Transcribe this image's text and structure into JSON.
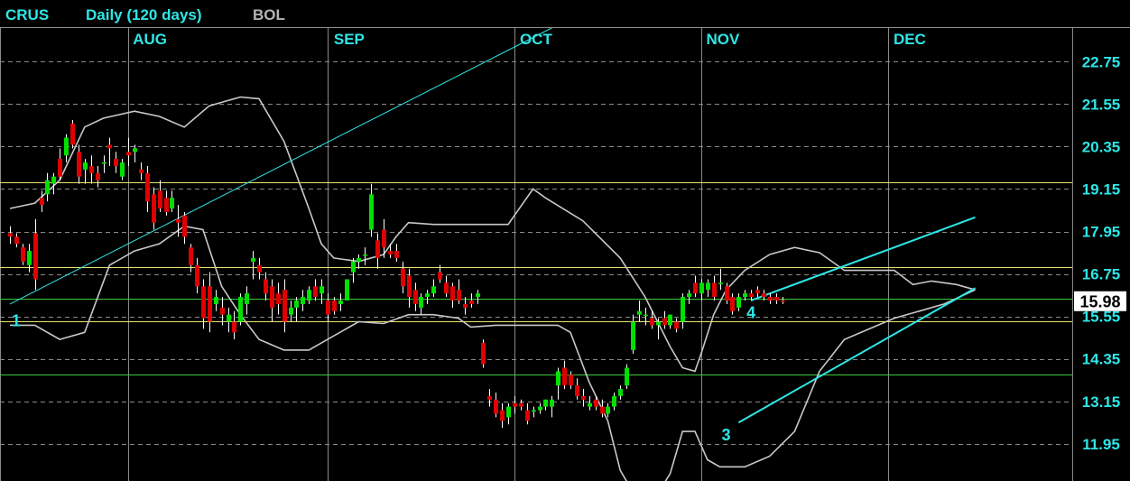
{
  "header": {
    "symbol": "CRUS",
    "period": "Daily (120 days)",
    "indicator": "BOL"
  },
  "colors": {
    "background": "#000000",
    "grid": "#8a8a8a",
    "axis_text": "#2ee6e6",
    "symbol_text": "#2ee6e6",
    "indicator_text": "#b4b4b4",
    "up_candle": "#00e000",
    "down_candle": "#e00000",
    "bollinger": "#c8c8c8",
    "trendline": "#2ee6e6",
    "h_line_yellow": "#e6e66e",
    "h_line_green": "#3cc83c",
    "last_price_bg": "#ffffff"
  },
  "chart_data": {
    "type": "candlestick",
    "y_ticks": [
      "22.75",
      "21.55",
      "20.35",
      "19.15",
      "17.95",
      "16.75",
      "15.55",
      "14.35",
      "13.15",
      "11.95"
    ],
    "ylim": [
      10.9,
      23.7
    ],
    "month_labels": [
      {
        "label": "AUG",
        "bar": 19
      },
      {
        "label": "SEP",
        "bar": 51
      },
      {
        "label": "OCT",
        "bar": 81
      },
      {
        "label": "NOV",
        "bar": 111
      },
      {
        "label": "DEC",
        "bar": 141
      }
    ],
    "last_price": "15.98",
    "last_price_value": 15.98,
    "candles": [
      [
        17.9,
        18.1,
        17.6,
        17.8
      ],
      [
        17.8,
        17.9,
        17.5,
        17.6
      ],
      [
        17.5,
        17.6,
        17.0,
        17.1
      ],
      [
        17.0,
        17.6,
        16.8,
        17.4
      ],
      [
        17.9,
        18.3,
        16.3,
        16.6
      ],
      [
        18.9,
        19.1,
        18.5,
        18.7
      ],
      [
        19.0,
        19.6,
        18.8,
        19.4
      ],
      [
        19.3,
        19.6,
        19.0,
        19.5
      ],
      [
        20.0,
        20.3,
        19.4,
        19.5
      ],
      [
        20.1,
        20.7,
        19.9,
        20.6
      ],
      [
        21.0,
        21.1,
        20.3,
        20.4
      ],
      [
        20.2,
        20.4,
        19.3,
        19.5
      ],
      [
        19.7,
        20.0,
        19.3,
        19.9
      ],
      [
        19.8,
        20.1,
        19.3,
        19.6
      ],
      [
        19.6,
        19.8,
        19.2,
        19.4
      ],
      [
        19.9,
        20.1,
        19.6,
        19.9
      ],
      [
        20.4,
        20.6,
        19.8,
        20.3
      ],
      [
        20.0,
        20.2,
        19.6,
        19.8
      ],
      [
        19.5,
        20.0,
        19.4,
        19.9
      ],
      [
        20.2,
        20.6,
        19.8,
        20.1
      ],
      [
        20.2,
        20.4,
        19.9,
        20.3
      ],
      [
        19.7,
        19.9,
        19.4,
        19.6
      ],
      [
        19.6,
        19.8,
        18.5,
        18.8
      ],
      [
        19.0,
        19.2,
        18.0,
        18.2
      ],
      [
        19.1,
        19.4,
        18.5,
        18.6
      ],
      [
        18.9,
        19.1,
        18.4,
        18.5
      ],
      [
        18.6,
        19.1,
        18.5,
        18.9
      ],
      [
        18.3,
        18.7,
        17.8,
        18.2
      ],
      [
        18.4,
        18.5,
        17.6,
        17.8
      ],
      [
        17.5,
        17.6,
        16.8,
        17.0
      ],
      [
        17.0,
        17.2,
        16.2,
        16.4
      ],
      [
        16.4,
        16.6,
        15.2,
        15.5
      ],
      [
        16.4,
        16.8,
        15.1,
        15.4
      ],
      [
        15.9,
        16.3,
        15.7,
        16.1
      ],
      [
        15.8,
        16.1,
        15.3,
        15.6
      ],
      [
        15.4,
        15.8,
        15.1,
        15.6
      ],
      [
        15.4,
        15.7,
        14.9,
        15.1
      ],
      [
        15.4,
        16.2,
        15.3,
        16.1
      ],
      [
        15.9,
        16.4,
        15.6,
        16.2
      ],
      [
        17.1,
        17.4,
        16.6,
        17.2
      ],
      [
        17.0,
        17.2,
        16.6,
        16.8
      ],
      [
        16.6,
        16.8,
        16.0,
        16.2
      ],
      [
        16.4,
        16.6,
        15.4,
        15.8
      ],
      [
        16.2,
        16.5,
        15.6,
        15.9
      ],
      [
        16.3,
        16.6,
        15.1,
        15.4
      ],
      [
        15.6,
        16.0,
        15.4,
        15.8
      ],
      [
        15.8,
        16.1,
        15.4,
        16.0
      ],
      [
        15.9,
        16.3,
        15.7,
        16.1
      ],
      [
        16.0,
        16.4,
        15.9,
        16.3
      ],
      [
        16.4,
        16.6,
        16.0,
        16.1
      ],
      [
        16.2,
        16.6,
        15.9,
        16.4
      ],
      [
        16.0,
        16.2,
        15.4,
        15.6
      ],
      [
        16.0,
        16.1,
        15.6,
        15.7
      ],
      [
        15.9,
        16.2,
        15.7,
        16.0
      ],
      [
        16.0,
        16.6,
        16.0,
        16.6
      ],
      [
        16.8,
        17.2,
        16.5,
        17.1
      ],
      [
        17.1,
        17.3,
        16.9,
        17.2
      ],
      [
        17.3,
        17.5,
        17.0,
        17.3
      ],
      [
        18.0,
        19.3,
        17.8,
        19.0
      ],
      [
        17.7,
        17.9,
        16.9,
        17.2
      ],
      [
        18.0,
        18.3,
        17.2,
        17.5
      ],
      [
        17.4,
        17.6,
        17.2,
        17.3
      ],
      [
        17.4,
        17.6,
        17.1,
        17.2
      ],
      [
        16.9,
        17.1,
        16.2,
        16.4
      ],
      [
        16.7,
        16.9,
        15.8,
        16.1
      ],
      [
        16.3,
        16.5,
        15.7,
        15.9
      ],
      [
        15.8,
        16.2,
        15.6,
        16.1
      ],
      [
        16.1,
        16.3,
        15.9,
        16.2
      ],
      [
        16.2,
        16.6,
        16.1,
        16.4
      ],
      [
        16.8,
        17.0,
        16.5,
        16.6
      ],
      [
        16.5,
        16.7,
        16.1,
        16.2
      ],
      [
        16.4,
        16.5,
        15.8,
        16.0
      ],
      [
        16.3,
        16.6,
        15.9,
        16.0
      ],
      [
        15.9,
        16.1,
        15.6,
        15.8
      ],
      [
        16.0,
        16.2,
        15.8,
        15.9
      ],
      [
        16.1,
        16.3,
        15.9,
        16.2
      ],
      [
        14.8,
        14.9,
        14.1,
        14.2
      ],
      [
        13.3,
        13.5,
        13.0,
        13.2
      ],
      [
        13.2,
        13.4,
        12.7,
        12.8
      ],
      [
        12.9,
        13.1,
        12.4,
        12.6
      ],
      [
        12.7,
        13.1,
        12.5,
        13.0
      ],
      [
        13.1,
        13.3,
        12.8,
        13.0
      ],
      [
        13.1,
        13.2,
        12.9,
        13.0
      ],
      [
        12.9,
        13.1,
        12.5,
        12.6
      ],
      [
        12.9,
        13.0,
        12.7,
        12.9
      ],
      [
        12.9,
        13.1,
        12.8,
        13.0
      ],
      [
        13.0,
        13.2,
        12.9,
        13.2
      ],
      [
        13.0,
        13.3,
        12.7,
        13.2
      ],
      [
        13.6,
        14.1,
        13.2,
        14.0
      ],
      [
        14.1,
        14.3,
        13.5,
        13.6
      ],
      [
        13.9,
        14.0,
        13.5,
        13.6
      ],
      [
        13.6,
        13.8,
        13.2,
        13.3
      ],
      [
        13.3,
        13.5,
        13.0,
        13.2
      ],
      [
        13.0,
        13.3,
        12.9,
        13.1
      ],
      [
        13.2,
        13.3,
        12.9,
        13.0
      ],
      [
        13.0,
        13.2,
        12.7,
        12.8
      ],
      [
        12.8,
        13.1,
        12.7,
        13.0
      ],
      [
        13.0,
        13.4,
        12.9,
        13.3
      ],
      [
        13.3,
        13.6,
        13.2,
        13.5
      ],
      [
        13.6,
        14.2,
        13.5,
        14.1
      ],
      [
        14.6,
        15.6,
        14.5,
        15.4
      ],
      [
        15.6,
        16.0,
        15.4,
        15.7
      ],
      [
        15.6,
        15.8,
        15.3,
        15.6
      ],
      [
        15.5,
        15.7,
        15.2,
        15.3
      ],
      [
        15.3,
        15.5,
        14.9,
        15.4
      ],
      [
        15.5,
        15.7,
        15.2,
        15.3
      ],
      [
        15.3,
        15.6,
        15.2,
        15.6
      ],
      [
        15.4,
        15.5,
        15.1,
        15.2
      ],
      [
        15.4,
        16.2,
        15.2,
        16.1
      ],
      [
        16.1,
        16.3,
        15.9,
        16.2
      ],
      [
        16.5,
        16.7,
        16.1,
        16.2
      ],
      [
        16.2,
        16.6,
        16.0,
        16.5
      ],
      [
        16.3,
        16.6,
        16.1,
        16.5
      ],
      [
        16.5,
        16.7,
        16.0,
        16.1
      ],
      [
        16.5,
        16.9,
        16.3,
        16.5
      ],
      [
        16.4,
        16.5,
        15.9,
        16.0
      ],
      [
        16.1,
        16.2,
        15.6,
        15.7
      ],
      [
        15.8,
        16.2,
        15.7,
        16.1
      ],
      [
        16.1,
        16.3,
        16.0,
        16.2
      ],
      [
        16.2,
        16.3,
        16.0,
        16.1
      ],
      [
        16.3,
        16.4,
        16.1,
        16.2
      ],
      [
        16.2,
        16.3,
        16.0,
        16.1
      ],
      [
        16.1,
        16.2,
        15.9,
        16.0
      ],
      [
        16.1,
        16.2,
        15.9,
        16.0
      ],
      [
        16.0,
        16.1,
        15.9,
        15.98
      ]
    ],
    "bollinger_upper": [
      [
        0,
        18.6
      ],
      [
        4,
        18.75
      ],
      [
        8,
        19.4
      ],
      [
        12,
        20.9
      ],
      [
        15,
        21.15
      ],
      [
        20,
        21.35
      ],
      [
        24,
        21.2
      ],
      [
        28,
        20.9
      ],
      [
        32,
        21.5
      ],
      [
        37,
        21.75
      ],
      [
        40,
        21.7
      ],
      [
        44,
        20.5
      ],
      [
        48,
        18.6
      ],
      [
        50,
        17.6
      ],
      [
        52,
        17.2
      ],
      [
        56,
        17.1
      ],
      [
        60,
        17.3
      ],
      [
        62,
        17.8
      ],
      [
        64,
        18.2
      ],
      [
        68,
        18.15
      ],
      [
        72,
        18.15
      ],
      [
        76,
        18.15
      ],
      [
        80,
        18.15
      ],
      [
        84,
        19.15
      ],
      [
        86,
        18.9
      ],
      [
        92,
        18.25
      ],
      [
        98,
        17.2
      ],
      [
        102,
        16.1
      ],
      [
        106,
        14.7
      ],
      [
        108,
        14.1
      ],
      [
        110,
        14.0
      ],
      [
        111,
        14.5
      ],
      [
        113,
        15.6
      ],
      [
        115,
        16.3
      ],
      [
        118,
        16.85
      ],
      [
        122,
        17.3
      ],
      [
        126,
        17.5
      ],
      [
        130,
        17.35
      ],
      [
        134,
        16.85
      ],
      [
        138,
        16.85
      ],
      [
        142,
        16.85
      ],
      [
        145,
        16.45
      ],
      [
        148,
        16.55
      ],
      [
        152,
        16.45
      ],
      [
        155,
        16.3
      ]
    ],
    "bollinger_lower": [
      [
        0,
        15.3
      ],
      [
        4,
        15.3
      ],
      [
        8,
        14.9
      ],
      [
        12,
        15.1
      ],
      [
        16,
        17.0
      ],
      [
        20,
        17.4
      ],
      [
        24,
        17.6
      ],
      [
        28,
        18.1
      ],
      [
        31,
        18.0
      ],
      [
        34,
        16.4
      ],
      [
        37,
        15.6
      ],
      [
        40,
        14.9
      ],
      [
        44,
        14.6
      ],
      [
        48,
        14.6
      ],
      [
        52,
        15.0
      ],
      [
        56,
        15.4
      ],
      [
        60,
        15.35
      ],
      [
        64,
        15.6
      ],
      [
        68,
        15.6
      ],
      [
        72,
        15.5
      ],
      [
        74,
        15.25
      ],
      [
        78,
        15.3
      ],
      [
        84,
        15.3
      ],
      [
        88,
        15.3
      ],
      [
        90,
        15.1
      ],
      [
        93,
        13.7
      ],
      [
        96,
        12.6
      ],
      [
        98,
        11.2
      ],
      [
        100,
        10.6
      ],
      [
        104,
        10.55
      ],
      [
        106,
        11.1
      ],
      [
        108,
        12.3
      ],
      [
        110,
        12.3
      ],
      [
        112,
        11.5
      ],
      [
        114,
        11.3
      ],
      [
        118,
        11.3
      ],
      [
        122,
        11.6
      ],
      [
        126,
        12.3
      ],
      [
        130,
        14.0
      ],
      [
        134,
        14.9
      ],
      [
        138,
        15.2
      ],
      [
        142,
        15.5
      ],
      [
        146,
        15.7
      ],
      [
        150,
        15.9
      ],
      [
        155,
        16.3
      ]
    ],
    "trendlines": [
      {
        "id": "long-up",
        "x1": 0,
        "y1": 15.9,
        "x2": 87,
        "y2": 23.7
      },
      {
        "id": "upper-channel",
        "x1": 119,
        "y1": 16.0,
        "x2": 155,
        "y2": 18.35
      },
      {
        "id": "lower-channel",
        "x1": 117,
        "y1": 12.55,
        "x2": 155,
        "y2": 16.35
      }
    ],
    "h_lines_yellow": [
      19.35,
      16.95,
      15.42
    ],
    "h_lines_green": [
      16.05,
      13.9
    ],
    "point_labels": [
      {
        "label": "1",
        "x": 1,
        "y": 15.42
      },
      {
        "label": "3",
        "x": 115,
        "y": 12.2
      },
      {
        "label": "4",
        "x": 119,
        "y": 15.65
      }
    ]
  }
}
